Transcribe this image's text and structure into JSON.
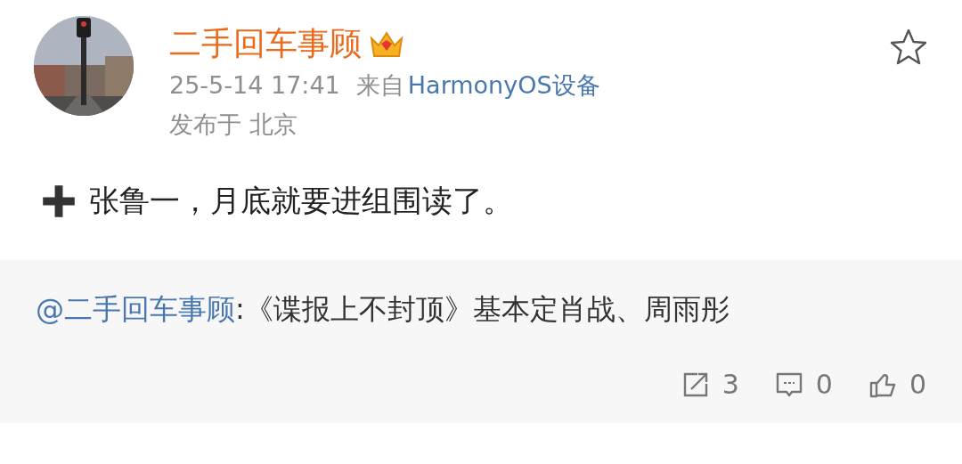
{
  "post": {
    "author": "二手回车事顾",
    "time": "25-5-14 17:41",
    "source_prefix": "来自",
    "source": "HarmonyOS设备",
    "location": "发布于 北京",
    "starred": false,
    "text": "张鲁一，月底就要进组围读了。"
  },
  "repost": {
    "author": "@二手回车事顾",
    "text": ":《谍报上不封顶》基本定肖战、周雨彤",
    "actions": [
      {
        "kind": "share",
        "count": "3"
      },
      {
        "kind": "comment",
        "count": "0"
      },
      {
        "kind": "like",
        "count": "0"
      }
    ]
  }
}
